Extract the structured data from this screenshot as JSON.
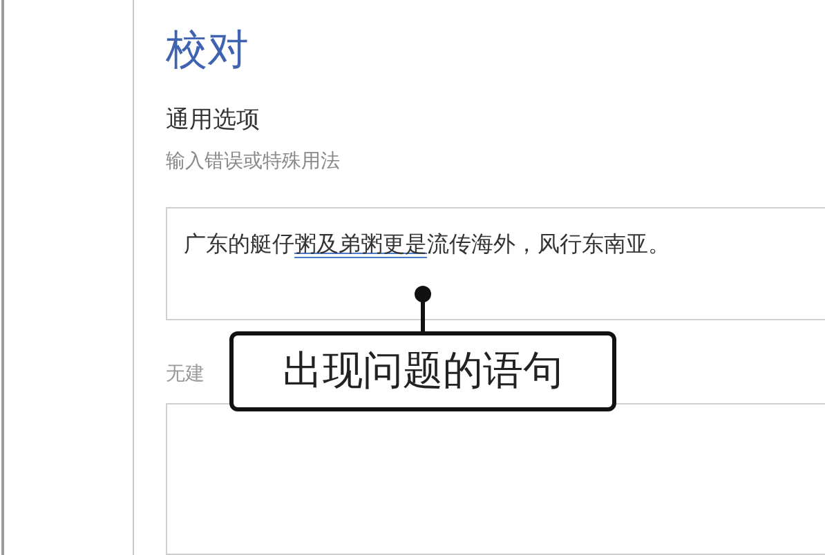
{
  "title": "校对",
  "section": {
    "heading": "通用选项",
    "subheading": "输入错误或特殊用法"
  },
  "input_sentence": {
    "segments": [
      {
        "text": "广东的艇仔",
        "flagged": false
      },
      {
        "text": "粥及弟粥更是",
        "flagged": true
      },
      {
        "text": "流传海外，风行东南亚。",
        "flagged": false
      }
    ]
  },
  "suggestions_label": "无建",
  "callout": {
    "text": "出现问题的语句"
  }
}
